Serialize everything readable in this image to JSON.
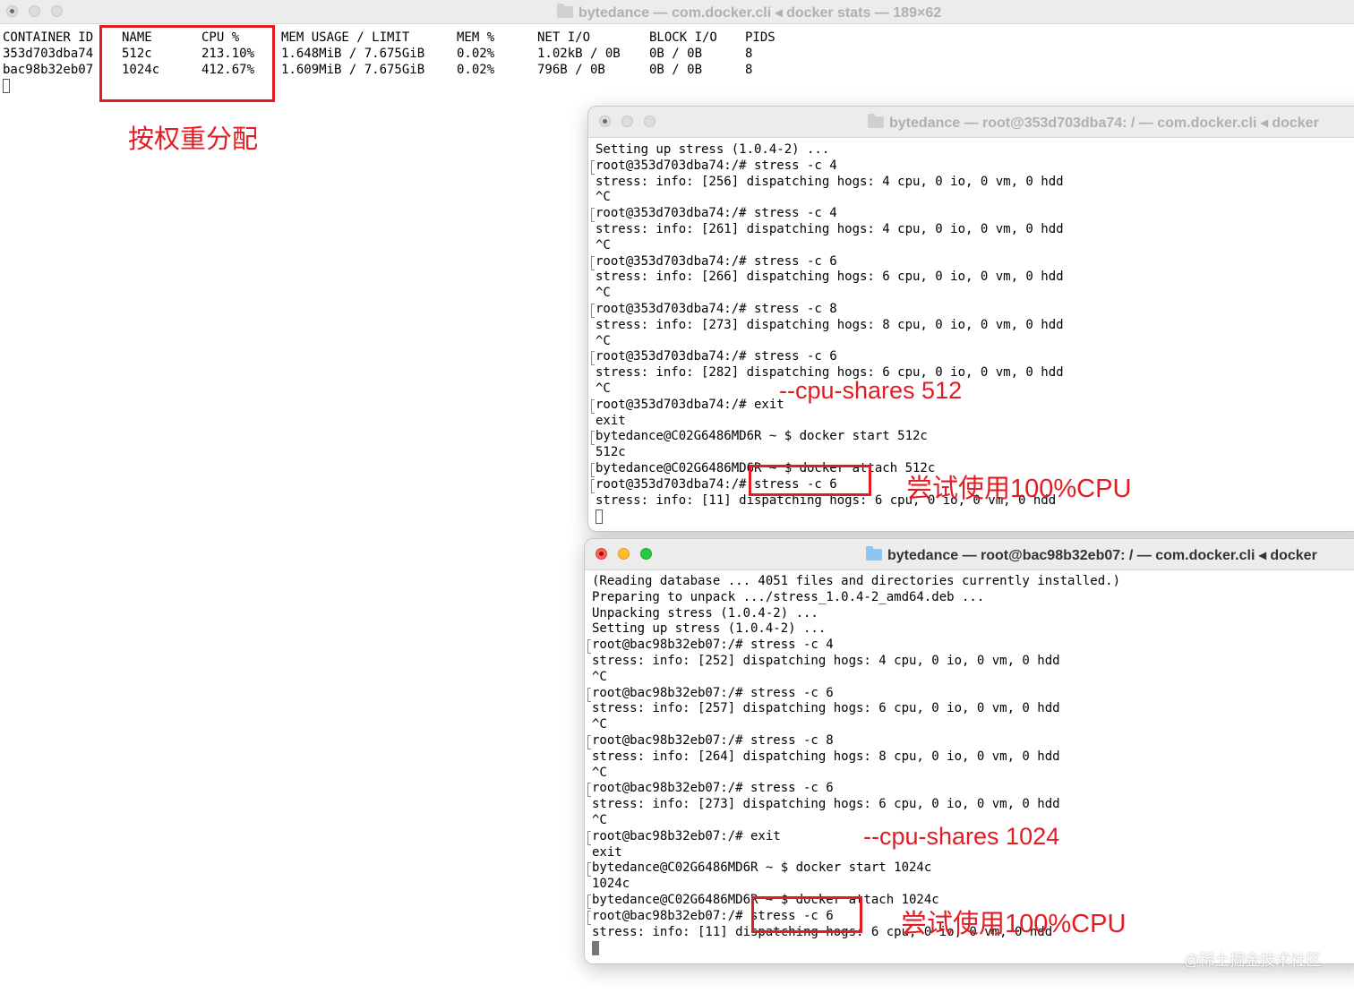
{
  "main_window": {
    "title": "bytedance — com.docker.cli ◂ docker stats — 189×62",
    "headers": [
      "CONTAINER ID",
      "NAME",
      "CPU %",
      "MEM USAGE / LIMIT",
      "MEM %",
      "NET I/O",
      "BLOCK I/O",
      "PIDS"
    ],
    "rows": [
      [
        "353d703dba74",
        "512c",
        "213.10%",
        "1.648MiB / 7.675GiB",
        "0.02%",
        "1.02kB / 0B",
        "0B / 0B",
        "8"
      ],
      [
        "bac98b32eb07",
        "1024c",
        "412.67%",
        "1.609MiB / 7.675GiB",
        "0.02%",
        "796B / 0B",
        "0B / 0B",
        "8"
      ]
    ]
  },
  "annotations": {
    "weighted": "按权重分配",
    "shares_512": "--cpu-shares 512",
    "try_full_cpu_1": "尝试使用100%CPU",
    "shares_1024": "--cpu-shares 1024",
    "try_full_cpu_2": "尝试使用100%CPU"
  },
  "window_512": {
    "title": "bytedance — root@353d703dba74: / — com.docker.cli ◂ docker",
    "lines": [
      "Setting up stress (1.0.4-2) ...",
      "root@353d703dba74:/# stress -c 4",
      "stress: info: [256] dispatching hogs: 4 cpu, 0 io, 0 vm, 0 hdd",
      "^C",
      "root@353d703dba74:/# stress -c 4",
      "stress: info: [261] dispatching hogs: 4 cpu, 0 io, 0 vm, 0 hdd",
      "^C",
      "root@353d703dba74:/# stress -c 6",
      "stress: info: [266] dispatching hogs: 6 cpu, 0 io, 0 vm, 0 hdd",
      "^C",
      "root@353d703dba74:/# stress -c 8",
      "stress: info: [273] dispatching hogs: 8 cpu, 0 io, 0 vm, 0 hdd",
      "^C",
      "root@353d703dba74:/# stress -c 6",
      "stress: info: [282] dispatching hogs: 6 cpu, 0 io, 0 vm, 0 hdd",
      "^C",
      "root@353d703dba74:/# exit",
      "exit",
      "bytedance@C02G6486MD6R ~ $ docker start 512c",
      "512c",
      "bytedance@C02G6486MD6R ~ $ docker attach 512c",
      "root@353d703dba74:/# stress -c 6",
      "stress: info: [11] dispatching hogs: 6 cpu, 0 io, 0 vm, 0 hdd"
    ]
  },
  "window_1024": {
    "title": "bytedance — root@bac98b32eb07: / — com.docker.cli ◂ docker",
    "lines": [
      "(Reading database ... 4051 files and directories currently installed.)",
      "Preparing to unpack .../stress_1.0.4-2_amd64.deb ...",
      "Unpacking stress (1.0.4-2) ...",
      "Setting up stress (1.0.4-2) ...",
      "root@bac98b32eb07:/# stress -c 4",
      "stress: info: [252] dispatching hogs: 4 cpu, 0 io, 0 vm, 0 hdd",
      "^C",
      "root@bac98b32eb07:/# stress -c 6",
      "stress: info: [257] dispatching hogs: 6 cpu, 0 io, 0 vm, 0 hdd",
      "^C",
      "root@bac98b32eb07:/# stress -c 8",
      "stress: info: [264] dispatching hogs: 8 cpu, 0 io, 0 vm, 0 hdd",
      "^C",
      "root@bac98b32eb07:/# stress -c 6",
      "stress: info: [273] dispatching hogs: 6 cpu, 0 io, 0 vm, 0 hdd",
      "^C",
      "root@bac98b32eb07:/# exit",
      "exit",
      "bytedance@C02G6486MD6R ~ $ docker start 1024c",
      "1024c",
      "bytedance@C02G6486MD6R ~ $ docker attach 1024c",
      "root@bac98b32eb07:/# stress -c 6",
      "stress: info: [11] dispatching hogs: 6 cpu, 0 io, 0 vm, 0 hdd"
    ]
  },
  "watermark": "@稀土掘金技术社区"
}
